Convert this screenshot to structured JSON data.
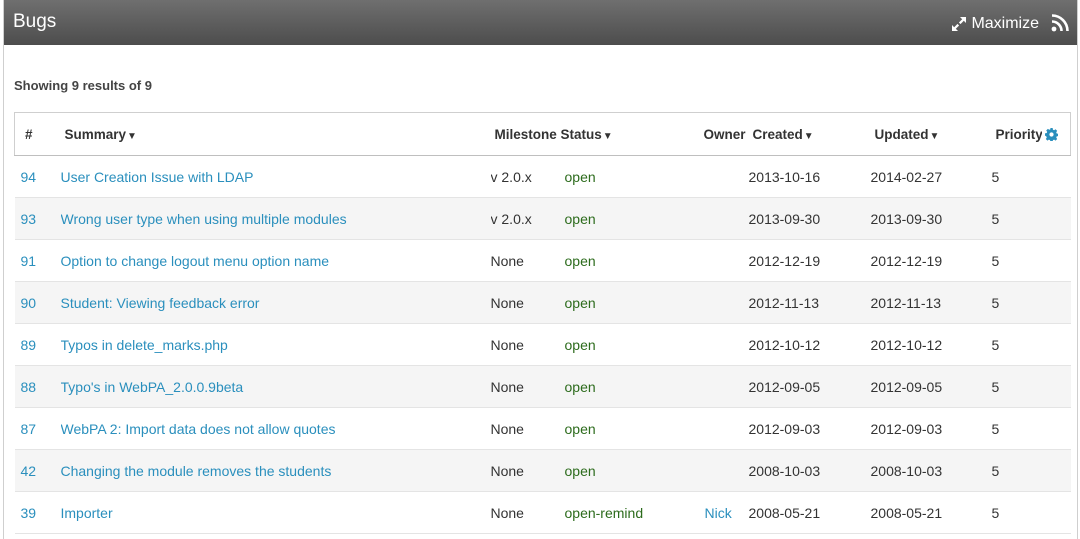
{
  "window": {
    "title": "Bugs",
    "maximize_label": "Maximize"
  },
  "results_text": "Showing 9 results of 9",
  "columns": {
    "num": "#",
    "summary": "Summary",
    "milestone": "Milestone",
    "status": "Status",
    "owner": "Owner",
    "created": "Created",
    "updated": "Updated",
    "priority": "Priority"
  },
  "sort_arrow": "▼",
  "rows": [
    {
      "id": "94",
      "summary": "User Creation Issue with LDAP",
      "milestone": "v 2.0.x",
      "status": "open",
      "owner": "",
      "created": "2013-10-16",
      "updated": "2014-02-27",
      "priority": "5"
    },
    {
      "id": "93",
      "summary": "Wrong user type when using multiple modules",
      "milestone": "v 2.0.x",
      "status": "open",
      "owner": "",
      "created": "2013-09-30",
      "updated": "2013-09-30",
      "priority": "5"
    },
    {
      "id": "91",
      "summary": "Option to change logout menu option name",
      "milestone": "None",
      "status": "open",
      "owner": "",
      "created": "2012-12-19",
      "updated": "2012-12-19",
      "priority": "5"
    },
    {
      "id": "90",
      "summary": "Student: Viewing feedback error",
      "milestone": "None",
      "status": "open",
      "owner": "",
      "created": "2012-11-13",
      "updated": "2012-11-13",
      "priority": "5"
    },
    {
      "id": "89",
      "summary": "Typos in delete_marks.php",
      "milestone": "None",
      "status": "open",
      "owner": "",
      "created": "2012-10-12",
      "updated": "2012-10-12",
      "priority": "5"
    },
    {
      "id": "88",
      "summary": "Typo's in WebPA_2.0.0.9beta",
      "milestone": "None",
      "status": "open",
      "owner": "",
      "created": "2012-09-05",
      "updated": "2012-09-05",
      "priority": "5"
    },
    {
      "id": "87",
      "summary": "WebPA 2: Import data does not allow quotes",
      "milestone": "None",
      "status": "open",
      "owner": "",
      "created": "2012-09-03",
      "updated": "2012-09-03",
      "priority": "5"
    },
    {
      "id": "42",
      "summary": "Changing the module removes the students",
      "milestone": "None",
      "status": "open",
      "owner": "",
      "created": "2008-10-03",
      "updated": "2008-10-03",
      "priority": "5"
    },
    {
      "id": "39",
      "summary": "Importer",
      "milestone": "None",
      "status": "open-remind",
      "owner": "Nick",
      "created": "2008-05-21",
      "updated": "2008-05-21",
      "priority": "5"
    }
  ],
  "colors": {
    "link": "#2a8fbd",
    "status": "#2c6b1c",
    "titlebar": "#5a5a5a"
  }
}
